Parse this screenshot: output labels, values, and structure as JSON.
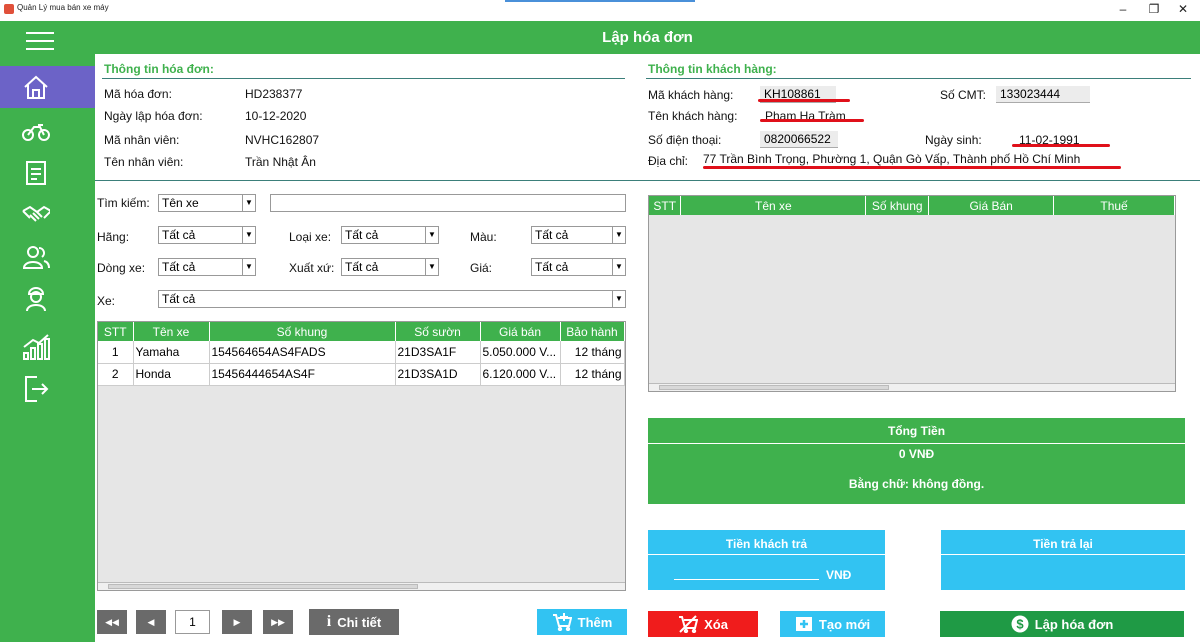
{
  "window": {
    "title": "Quản Lý mua bán xe máy",
    "min": "–",
    "max": "❐",
    "close": "✕"
  },
  "header": {
    "title": "Lập hóa đơn"
  },
  "sidebar": {
    "items": [
      "menu",
      "home",
      "motorbike",
      "invoice",
      "handshake",
      "customers",
      "employee",
      "statistics",
      "logout"
    ]
  },
  "invoice_info": {
    "title": "Thông tin hóa đơn:",
    "rows": [
      {
        "label": "Mã hóa đơn:",
        "value": "HD238377"
      },
      {
        "label": "Ngày lập hóa đơn:",
        "value": "10-12-2020"
      },
      {
        "label": "Mã nhân viên:",
        "value": "NVHC162807"
      },
      {
        "label": "Tên nhân viên:",
        "value": "Trần Nhật Ân"
      }
    ]
  },
  "customer_info": {
    "title": "Thông tin khách hàng:",
    "code_label": "Mã khách hàng:",
    "code": "KH108861",
    "name_label": "Tên khách hàng:",
    "name": "Phạm Hạ Tràm",
    "phone_label": "Số điện thoại:",
    "phone": "0820066522",
    "address_label": "Địa chỉ:",
    "address": "77 Trần Bình Trọng, Phường 1, Quận Gò Vấp, Thành phố Hồ Chí Minh",
    "id_label": "Số CMT:",
    "id": "133023444",
    "dob_label": "Ngày sinh:",
    "dob": "11-02-1991"
  },
  "filters": {
    "search_label": "Tìm kiếm:",
    "search_by": "Tên xe",
    "search_value": "",
    "brand_label": "Hãng:",
    "brand": "Tất cả",
    "type_label": "Loại xe:",
    "type": "Tất cả",
    "color_label": "Màu:",
    "color": "Tất cả",
    "line_label": "Dòng xe:",
    "line": "Tất cả",
    "origin_label": "Xuất xứ:",
    "origin": "Tất cả",
    "price_label": "Giá:",
    "price": "Tất cả",
    "bike_label": "Xe:",
    "bike": "Tất cả"
  },
  "bike_table": {
    "headers": [
      "STT",
      "Tên xe",
      "Số khung",
      "Số sườn",
      "Giá bán",
      "Bảo hành"
    ],
    "rows": [
      [
        "1",
        "Yamaha",
        "154564654AS4FADS",
        "21D3SA1F",
        "5.050.000 V...",
        "12 tháng"
      ],
      [
        "2",
        "Honda",
        "15456444654AS4F",
        "21D3SA1D",
        "6.120.000 V...",
        "12 tháng"
      ]
    ]
  },
  "cart_table": {
    "headers": [
      "STT",
      "Tên xe",
      "Số khung",
      "Giá Bán",
      "Thuế"
    ]
  },
  "totals": {
    "title": "Tổng Tiền",
    "amount": "0 VNĐ",
    "in_words": "Bằng chữ: không đồng."
  },
  "payment": {
    "paid_title": "Tiền khách trả",
    "paid_value": "",
    "currency": "VNĐ",
    "change_title": "Tiền trả lại"
  },
  "pager": {
    "first": "◀◀",
    "prev": "◀",
    "page": "1",
    "next": "▶",
    "last": "▶▶"
  },
  "buttons": {
    "detail": "Chi tiết",
    "add": "Thêm",
    "delete": "Xóa",
    "new": "Tạo mới",
    "create_invoice": "Lập hóa đơn"
  },
  "colors": {
    "green": "#3fb14d",
    "dark_green": "#1f9a45",
    "cyan": "#32c3f2",
    "red": "#f01c1c",
    "purple": "#6c63c7",
    "gray": "#6a6a6a"
  }
}
